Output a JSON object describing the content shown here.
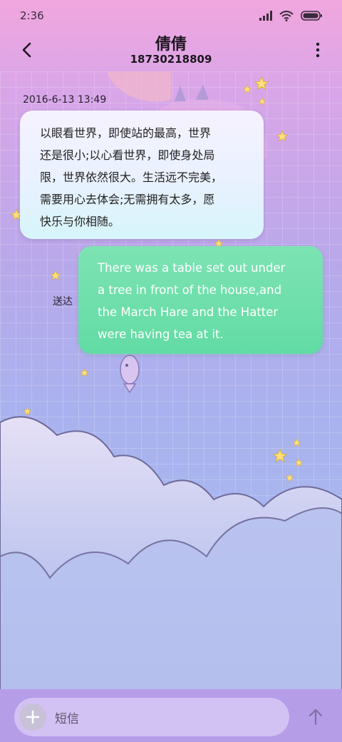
{
  "status_bar": {
    "time": "2:36",
    "icons": [
      "signal-icon",
      "wifi-icon",
      "battery-icon"
    ]
  },
  "header": {
    "contact_name": "倩倩",
    "contact_number": "18730218809",
    "back_icon": "chevron-left-icon",
    "more_icon": "more-vertical-icon"
  },
  "conversation": {
    "timestamp": "2016-6-13 13:49",
    "incoming_message": {
      "lines": [
        "以眼看世界，即使站的最高，世界",
        "还是很小;以心看世界，即使身处局",
        "限，世界依然很大。生活远不完美，",
        "需要用心去体会;无需拥有太多，愿",
        "快乐与你相随。"
      ]
    },
    "outgoing_message": {
      "lines": [
        "There was a table set out under",
        "a tree in front of the house,and",
        "the March Hare and the Hatter",
        "were having tea at it."
      ],
      "status": "送达"
    }
  },
  "composer": {
    "placeholder": "短信",
    "add_icon": "plus-icon",
    "send_icon": "arrow-up-icon"
  },
  "colors": {
    "incoming_bubble": "#eef1ff",
    "outgoing_bubble": "#6bdda9",
    "composer_bar": "#b69de8"
  }
}
